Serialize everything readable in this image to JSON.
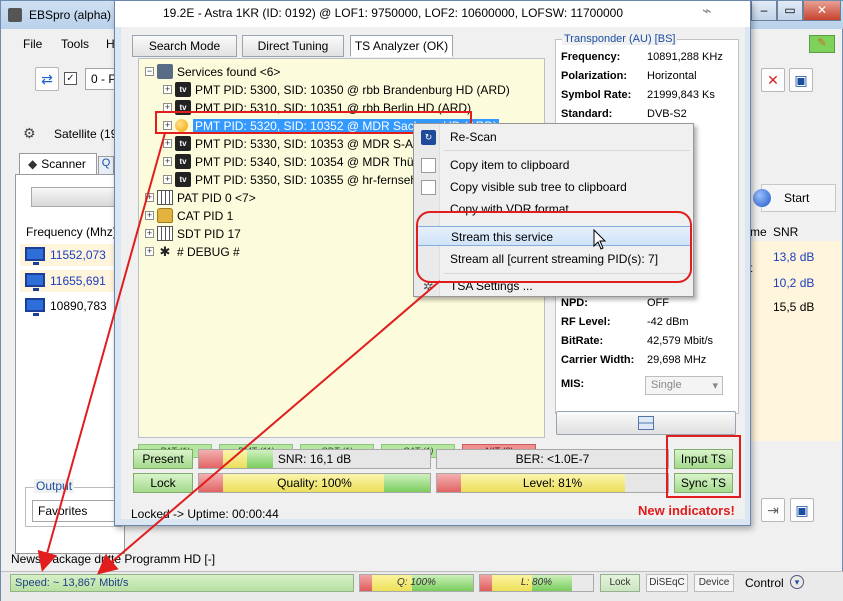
{
  "main_window": {
    "title": "EBSpro (alpha)",
    "minimize": "–",
    "close": "✕",
    "menu": [
      "File",
      "Tools",
      "H"
    ],
    "toolbar": {
      "select_value": "0 - Pr"
    },
    "satellite_label": "Satellite (19",
    "tabs": {
      "scanner": "Scanner"
    },
    "frequency_header": "Frequency (Mhz)",
    "frequencies": [
      "11552,073",
      "11655,691",
      "10890,783"
    ],
    "start_label": "Start",
    "snr_header": "SNR",
    "name_header_fragment": "me",
    "snr_values": [
      "13,8 dB",
      "10,2 dB",
      "15,5 dB"
    ],
    "fragment_t": "t",
    "output_label": "Output",
    "favorites_value": "Favorites",
    "news_line": "News Package dritte Programm HD [-]",
    "status_bar": {
      "speed": "Speed: ~ 13,867 Mbit/s",
      "quality": "Q: 100%",
      "level": "L: 80%",
      "lock": "Lock",
      "diseqc": "DiSEqC",
      "device": "Device",
      "control": "Control"
    }
  },
  "ts_window": {
    "title": "19.2E - Astra 1KR (ID: 0192) @ LOF1: 9750000, LOF2: 10600000, LOFSW: 11700000",
    "tabs": [
      "Search Mode",
      "Direct Tuning",
      "TS Analyzer (OK)"
    ],
    "tree": {
      "root": "Services found <6>",
      "services": [
        "PMT PID: 5300, SID: 10350 @ rbb Brandenburg HD (ARD)",
        "PMT PID: 5310, SID: 10351 @ rbb Berlin HD (ARD)",
        "PMT PID: 5320, SID: 10352 @ MDR Sachsen HD (ARD)",
        "PMT PID: 5330, SID: 10353 @ MDR S-Anhalt HD (ARD)",
        "PMT PID: 5340, SID: 10354 @ MDR Thüringen HD (ARD)",
        "PMT PID: 5350, SID: 10355 @ hr-fernsehen HD (ARD)"
      ],
      "others": [
        "PAT PID 0 <7>",
        "CAT PID 1",
        "SDT PID 17",
        "# DEBUG #"
      ]
    },
    "counters": [
      "PAT (1)",
      "PMT (11)",
      "SDT (1)",
      "CAT (1)",
      "NIT (0)"
    ],
    "buttons": {
      "present": "Present",
      "lock": "Lock",
      "input_ts": "Input TS",
      "sync_ts": "Sync TS"
    },
    "meters": {
      "snr": {
        "label": "SNR: 16,1 dB",
        "fraction": 0.35
      },
      "ber": {
        "label": "BER: <1.0E-7"
      },
      "quality": {
        "label": "Quality: 100%",
        "fraction": 1.0
      },
      "level": {
        "label": "Level: 81%",
        "fraction": 0.81
      }
    },
    "transponder": {
      "title": "Transponder (AU) [BS]",
      "fields": [
        {
          "key": "Frequency:",
          "value": "10891,288 KHz"
        },
        {
          "key": "Polarization:",
          "value": "Horizontal"
        },
        {
          "key": "Symbol Rate:",
          "value": "21999,843 Ks"
        },
        {
          "key": "Standard:",
          "value": "DVB-S2"
        }
      ],
      "lower_fields": [
        {
          "key": "NPD:",
          "value": "OFF"
        },
        {
          "key": "RF Level:",
          "value": "-42 dBm"
        },
        {
          "key": "BitRate:",
          "value": "42,579 Mbit/s"
        },
        {
          "key": "Carrier Width:",
          "value": "29,698 MHz"
        }
      ],
      "mis_label": "MIS:",
      "mis_value": "Single"
    },
    "status": "Locked -> Uptime: 00:00:44",
    "new_indicators": "New indicators!"
  },
  "context_menu": {
    "items": [
      "Re-Scan",
      "Copy item to clipboard",
      "Copy visible sub tree to clipboard",
      "Copy with VDR format",
      "Stream this service",
      "Stream all [current streaming PID(s): 7]",
      "TSA Settings ..."
    ]
  },
  "colors": {
    "highlight_red": "#e11d1d",
    "selection_blue": "#3399ff",
    "link_blue": "#1a4ea0"
  }
}
